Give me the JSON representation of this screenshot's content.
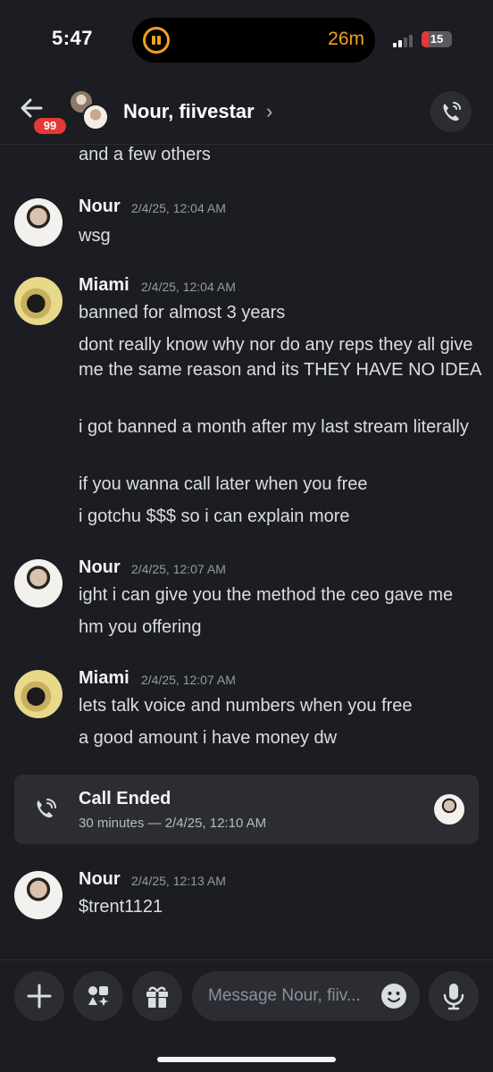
{
  "status_bar": {
    "time": "5:47",
    "activity_timer": "26m",
    "battery": "15",
    "battery_color": "#e03a3a"
  },
  "header": {
    "unread_badge": "99",
    "title": "Nour, fiivestar",
    "chevron": "›"
  },
  "messages": {
    "continued_text": "and a few others",
    "groups": [
      {
        "author": "Nour",
        "timestamp": "2/4/25, 12:04 AM",
        "lines": [
          "wsg"
        ]
      },
      {
        "author": "Miami",
        "timestamp": "2/4/25, 12:04 AM",
        "lines": [
          "banned for almost 3 years",
          "dont really know why nor do any reps they all give me the same reason and its THEY HAVE NO IDEA",
          "i got banned a month after my last stream literally",
          "if you wanna call later when you free",
          "i gotchu $$$ so i can explain more"
        ]
      },
      {
        "author": "Nour",
        "timestamp": "2/4/25, 12:07 AM",
        "lines": [
          "ight i can give you the method the ceo gave me",
          "hm you offering"
        ]
      },
      {
        "author": "Miami",
        "timestamp": "2/4/25, 12:07 AM",
        "lines": [
          "lets talk voice and numbers when you free",
          "a good amount i have money dw"
        ]
      },
      {
        "author": "Nour",
        "timestamp": "2/4/25, 12:13 AM",
        "lines": [
          "$trent1121"
        ]
      }
    ],
    "call_card": {
      "title": "Call Ended",
      "subtitle": "30 minutes — 2/4/25, 12:10 AM"
    }
  },
  "composer": {
    "placeholder": "Message Nour, fiiv..."
  },
  "colors": {
    "background": "#1c1d22",
    "surface": "#2b2d33",
    "accent_orange": "#f0a020",
    "badge_red": "#e53935"
  }
}
